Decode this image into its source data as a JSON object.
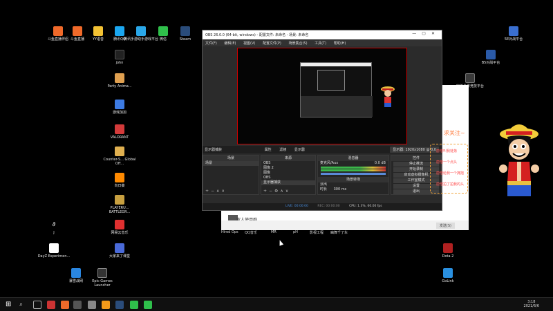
{
  "desktop": {
    "icons": [
      {
        "label": "斗鱼直播伴侣",
        "color": "#f06a2a"
      },
      {
        "label": "斗鱼直播",
        "color": "#f06a2a"
      },
      {
        "label": "YY语音",
        "color": "#f3c234"
      },
      {
        "label": "腾讯QQ",
        "color": "#1ba7f0"
      },
      {
        "label": "腾讯手游助手游戏平台",
        "color": "#2aa7e8"
      },
      {
        "label": "微信",
        "color": "#2fbf4b"
      },
      {
        "label": "Steam",
        "color": "#2a4c7a"
      },
      {
        "label": "john",
        "color": "#cccccc"
      },
      {
        "label": "Party Anima...",
        "color": "#e0a050"
      },
      {
        "label": "游戏加加",
        "color": "#3d7be3"
      },
      {
        "label": "VALORANT",
        "color": "#d33a3a"
      },
      {
        "label": "Counter-S... Global Off...",
        "color": "#e0b050"
      },
      {
        "label": "向日葵",
        "color": "#ff8a00"
      },
      {
        "label": "PLAYERU... BATTLEGR...",
        "color": "#c8a040"
      },
      {
        "label": "网易云音乐",
        "color": "#e03030"
      },
      {
        "label": "J",
        "color": "#eeeeee"
      },
      {
        "label": "DayZ Experimen...",
        "color": "#ffffff"
      },
      {
        "label": "大家来了课堂",
        "color": "#4a6ad8"
      },
      {
        "label": "暴雪战网",
        "color": "#2a86e0"
      },
      {
        "label": "Epic Games Launcher",
        "color": "#333333"
      },
      {
        "label": "5E对战平台",
        "color": "#3a6fd0"
      },
      {
        "label": "B5对战平台",
        "color": "#2a5aa8"
      },
      {
        "label": "完美世界竞技平台",
        "color": "#3a3a3a"
      },
      {
        "label": "Dota 2",
        "color": "#b02020"
      },
      {
        "label": "GoLink",
        "color": "#2a90e0"
      }
    ],
    "side_label": "Hired Ops",
    "lower_labels": [
      "QQ音乐",
      "MR",
      "pH",
      "影视工程",
      "幽舞千了车"
    ]
  },
  "obs": {
    "title": "OBS 26.0.0 (64-bit, windows) - 配置文件: 未命名 - 场景: 未命名",
    "menu": [
      "文件(F)",
      "编辑(E)",
      "视图(V)",
      "配置文件(P)",
      "场景集合(S)",
      "工具(T)",
      "帮助(H)"
    ],
    "controls_bar": {
      "left": "显示器捕获",
      "properties": "属性",
      "filters": "滤镜",
      "display": "显示器",
      "resolution": "显示器: 1920x1080 @ 0,0"
    },
    "scenes": {
      "header": "场景",
      "items": [
        "场景"
      ]
    },
    "sources": {
      "header": "来源",
      "items": [
        "OBS",
        "图像 2",
        "图像",
        "OBS",
        "显示器捕获"
      ]
    },
    "mixer": {
      "header": "混音器",
      "track": "麦克风/Aux",
      "db": "0.0 dB",
      "filter_header": "场景转场",
      "transition": "淡出",
      "duration_label": "时长",
      "duration": "300 ms"
    },
    "controls": {
      "header": "控件",
      "buttons": [
        "停止推流",
        "开始录制",
        "启动虚拟摄像机",
        "工作室模式",
        "设置",
        "退出"
      ]
    },
    "status": {
      "live": "LIVE: 00:00:00",
      "rec": "REC: 00:00:00",
      "cpu": "CPU: 1.3%, 60.00 fps"
    }
  },
  "chat": {
    "item": "家人使用群",
    "send_button": "发送(S)"
  },
  "sticker": {
    "follow": "求关注~",
    "lines": [
      "唐僧叫我徒弟",
      "唐僧一个点头",
      "唐僧给我一个拥抱",
      "唐僧拍了拍我的头"
    ]
  },
  "taskbar": {
    "time": "3:18",
    "date": "2021/6/6"
  }
}
